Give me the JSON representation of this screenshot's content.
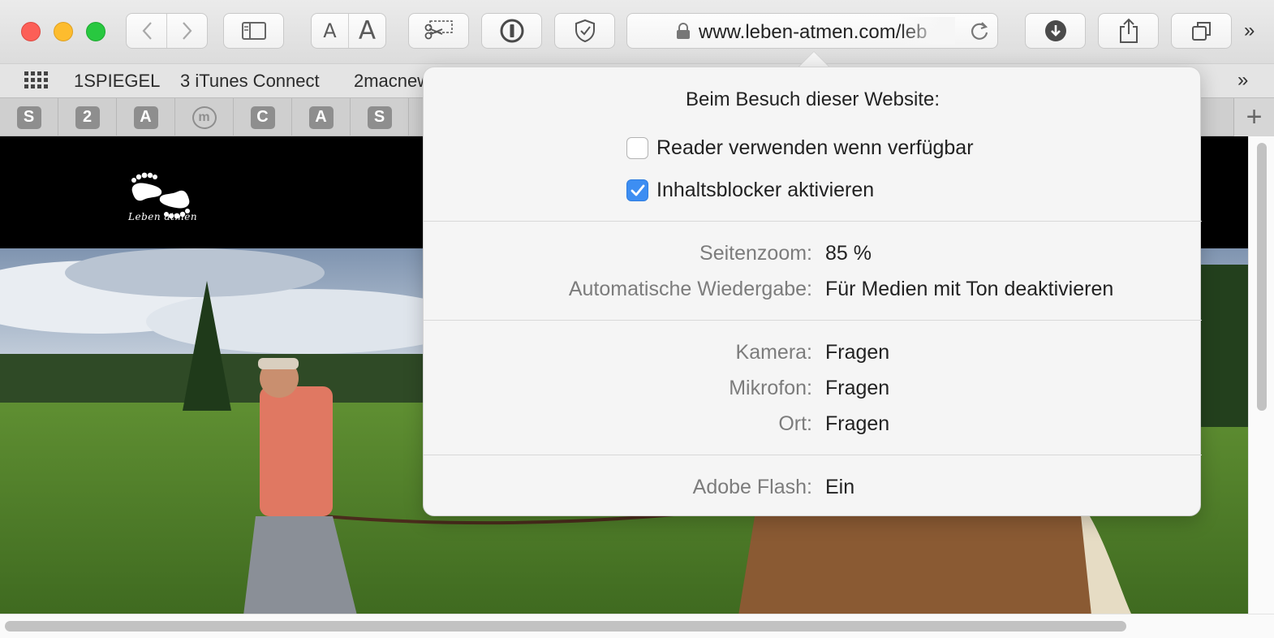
{
  "toolbar": {
    "url": "www.leben-atmen.com/leb",
    "text_size_small": "A",
    "text_size_large": "A",
    "more_glyph": "»"
  },
  "favorites": {
    "items": [
      "1SPIEGEL",
      "3 iTunes Connect",
      "2macnew"
    ],
    "more_glyph": "»"
  },
  "tabs": {
    "icons": [
      "S",
      "2",
      "A",
      "m",
      "C",
      "A",
      "S"
    ],
    "new_tab_glyph": "+"
  },
  "site": {
    "logo_text": "Leben atmen"
  },
  "popover": {
    "title": "Beim Besuch dieser Website:",
    "reader": {
      "label": "Reader verwenden wenn verfügbar",
      "checked": false
    },
    "content_blocker": {
      "label": "Inhaltsblocker aktivieren",
      "checked": true
    },
    "zoom": {
      "label": "Seitenzoom:",
      "value": "85 %"
    },
    "autoplay": {
      "label": "Automatische Wiedergabe:",
      "value": "Für Medien mit Ton deaktivieren"
    },
    "camera": {
      "label": "Kamera:",
      "value": "Fragen"
    },
    "microphone": {
      "label": "Mikrofon:",
      "value": "Fragen"
    },
    "location": {
      "label": "Ort:",
      "value": "Fragen"
    },
    "flash": {
      "label": "Adobe Flash:",
      "value": "Ein"
    }
  },
  "colors": {
    "checkbox_accent": "#3d8ef2",
    "traffic_close": "#fc5f57",
    "traffic_minimize": "#fdbc2e",
    "traffic_zoom": "#28c840"
  }
}
